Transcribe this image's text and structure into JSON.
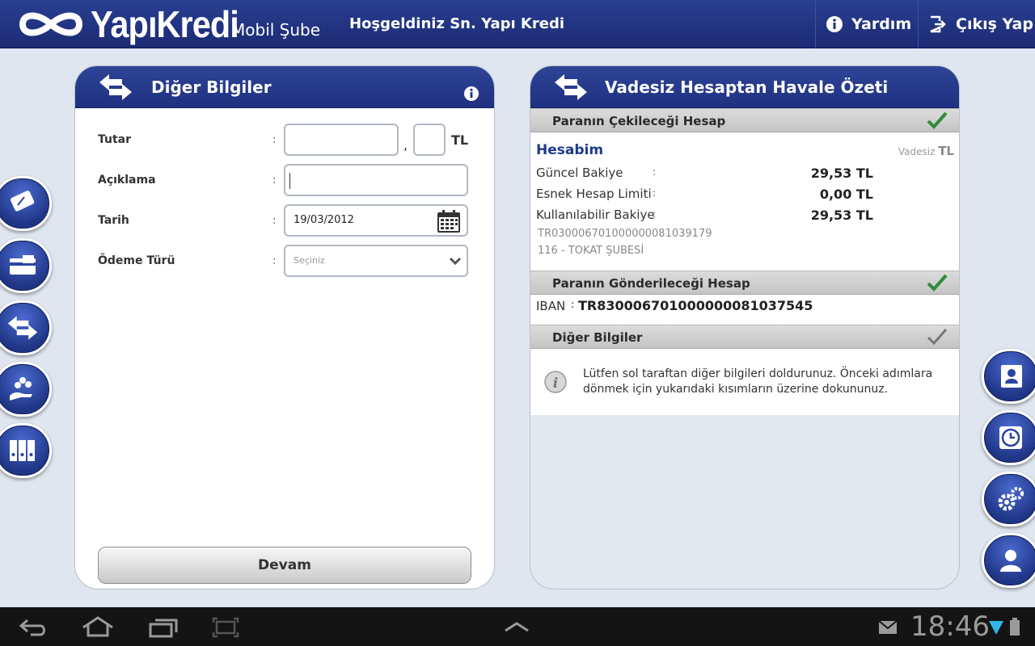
{
  "header": {
    "brand": "YapıKredi",
    "brand_sub": "Mobil Şube",
    "welcome": "Hoşgeldiniz Sn. Yapı Kredi",
    "help_label": "Yardım",
    "exit_label": "Çıkış Yap"
  },
  "left_panel": {
    "title": "Diğer Bilgiler",
    "fields": {
      "amount_label": "Tutar",
      "amount_value": "",
      "amount_decimal": "",
      "currency": "TL",
      "comma": ",",
      "description_label": "Açıklama",
      "description_value": "",
      "date_label": "Tarih",
      "date_value": "19/03/2012",
      "payment_type_label": "Ödeme Türü",
      "payment_type_placeholder": "Seçiniz",
      "colon": ":"
    },
    "continue_label": "Devam"
  },
  "right_panel": {
    "title": "Vadesiz Hesaptan Havale Özeti",
    "source": {
      "section_label": "Paranın Çekileceği Hesap",
      "account_name": "Hesabim",
      "account_type": "Vadesiz",
      "account_currency": "TL",
      "rows": [
        {
          "label": "Güncel Bakiye",
          "value": "29,53 TL"
        },
        {
          "label": "Esnek Hesap Limiti",
          "value": "0,00 TL"
        },
        {
          "label": "Kullanılabilir Bakiye",
          "value": "29,53 TL"
        }
      ],
      "iban": "TR030006701000000081039179",
      "branch": "116 - TOKAT ŞUBESİ"
    },
    "target": {
      "section_label": "Paranın Gönderileceği Hesap",
      "iban_label": "IBAN",
      "iban_value": "TR830006701000000081037545"
    },
    "other": {
      "section_label": "Diğer Bilgiler",
      "message": "Lütfen sol taraftan diğer bilgileri doldurunuz. Önceki adımlara dönmek için yukarıdaki kısımların üzerine dokununuz."
    }
  },
  "side_left_icons": [
    "card-icon",
    "credit-card-icon",
    "transfer-icon",
    "payments-icon",
    "binders-icon"
  ],
  "side_right_icons": [
    "contacts-icon",
    "clock-icon",
    "settings-icon",
    "profile-icon"
  ],
  "system_bar": {
    "time": "18:46"
  },
  "colors": {
    "header": "#1f3080",
    "accent": "#1e3a8a",
    "check_green": "#2e8b3a"
  }
}
